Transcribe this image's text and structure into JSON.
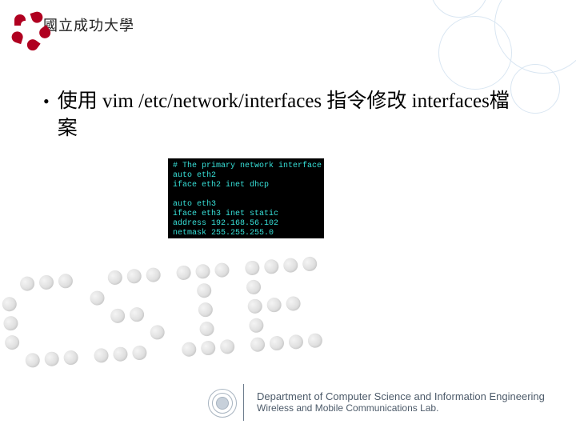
{
  "logo": {
    "university_name": "國立成功大學"
  },
  "bullet": {
    "text": "使用 vim /etc/network/interfaces 指令修改 interfaces檔案"
  },
  "terminal": {
    "lines": [
      "# The primary network interface",
      "auto eth2",
      "iface eth2 inet dhcp",
      "",
      "auto eth3",
      "iface eth3 inet static",
      "address 192.168.56.102",
      "netmask 255.255.255.0"
    ]
  },
  "watermark": {
    "text": "CSIE"
  },
  "footer": {
    "line1": "Department of Computer Science and Information Engineering",
    "line2": "Wireless and Mobile Communications Lab."
  }
}
